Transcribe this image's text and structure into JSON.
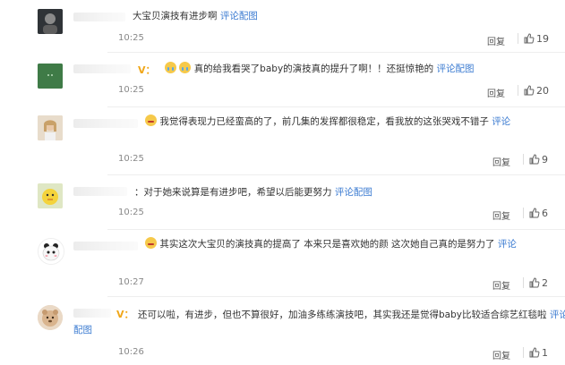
{
  "comments": [
    {
      "text": "大宝贝演技有进步啊",
      "link": "评论配图",
      "time": "10:25",
      "reply": "回复",
      "likes": "19"
    },
    {
      "verified": "V：",
      "text": "真的给我看哭了baby的演技真的提升了啊！！还挺惊艳的",
      "link": "评论配图",
      "time": "10:25",
      "reply": "回复",
      "likes": "20"
    },
    {
      "text": "我觉得表现力已经蛮高的了，前几集的发挥都很稳定，看我放的这张哭戏不错子",
      "link": "评论",
      "time": "10:25",
      "reply": "回复",
      "likes": "9"
    },
    {
      "text": "：对于她来说算是有进步吧，希望以后能更努力",
      "link": "评论配图",
      "time": "10:25",
      "reply": "回复",
      "likes": "6"
    },
    {
      "text": "其实这次大宝贝的演技真的提高了 本来只是喜欢她的颜 这次她自己真的是努力了",
      "link": "评论",
      "time": "10:27",
      "reply": "回复",
      "likes": "2"
    },
    {
      "verified": "V：",
      "text": "还可以啦，有进步，但也不算很好，加油多练练演技吧，其实我还是觉得baby比较适合综艺红毯啦",
      "link": "评论配图",
      "time": "10:26",
      "reply": "回复",
      "likes": "1"
    }
  ],
  "colors": {
    "link": "#3b7bd1",
    "verified": "#f0a71a"
  }
}
